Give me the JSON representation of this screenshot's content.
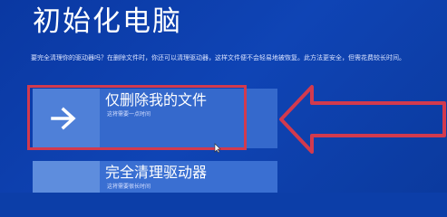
{
  "page": {
    "title": "初始化电脑",
    "description": "要完全清理你的驱动器吗？在删除文件时，你还可以清理驱动器，这样文件便不会轻易地被恢复。此方法更安全，但需花费较长时间。"
  },
  "options": [
    {
      "title": "仅删除我的文件",
      "subtitle": "这将需要一点时间",
      "icon": "arrow-right-icon"
    },
    {
      "title": "完全清理驱动器",
      "subtitle": "这将需要很长时间",
      "icon": "arrow-right-icon"
    }
  ],
  "colors": {
    "background": "#0c3ea8",
    "tile": "#4f80d8",
    "panel": "#3569cc",
    "highlight": "#d23a4e"
  },
  "annotations": {
    "highlight_icon": "red-outline-box",
    "pointer_icon": "red-left-arrow-icon"
  }
}
